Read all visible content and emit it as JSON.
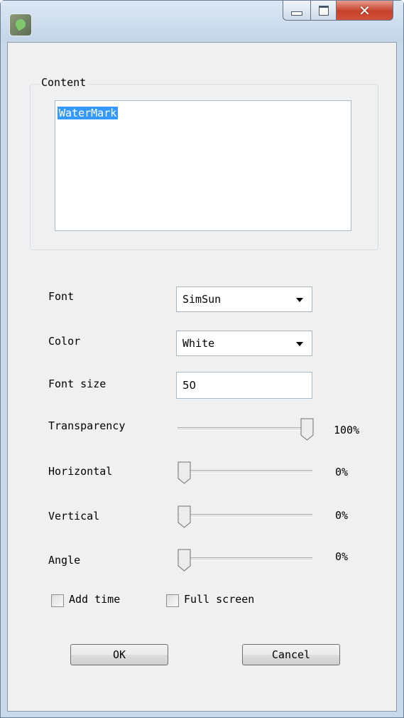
{
  "window": {
    "title": "",
    "icon": "app-leaf-icon",
    "caption_buttons": [
      "minimize-icon",
      "maximize-icon",
      "close-icon"
    ]
  },
  "content_group": {
    "title": "Content",
    "text": "WaterMark"
  },
  "font": {
    "label": "Font",
    "value": "SimSun"
  },
  "color": {
    "label": "Color",
    "value": "White"
  },
  "font_size": {
    "label": "Font size",
    "value": "50"
  },
  "sliders": [
    {
      "label": "Transparency",
      "value_text": "100%",
      "value": 100
    },
    {
      "label": "Horizontal",
      "value_text": "0%",
      "value": 0
    },
    {
      "label": "Vertical",
      "value_text": "0%",
      "value": 0
    },
    {
      "label": "Angle",
      "value_text": "0%",
      "value": 0
    }
  ],
  "checkboxes": [
    {
      "label": "Add time",
      "checked": false
    },
    {
      "label": "Full screen",
      "checked": false
    }
  ],
  "buttons": {
    "ok": "OK",
    "cancel": "Cancel"
  },
  "colors": {
    "selection": "#3399ff",
    "close_button": "#c6402a",
    "dialog_bg": "#f0f0f0"
  }
}
